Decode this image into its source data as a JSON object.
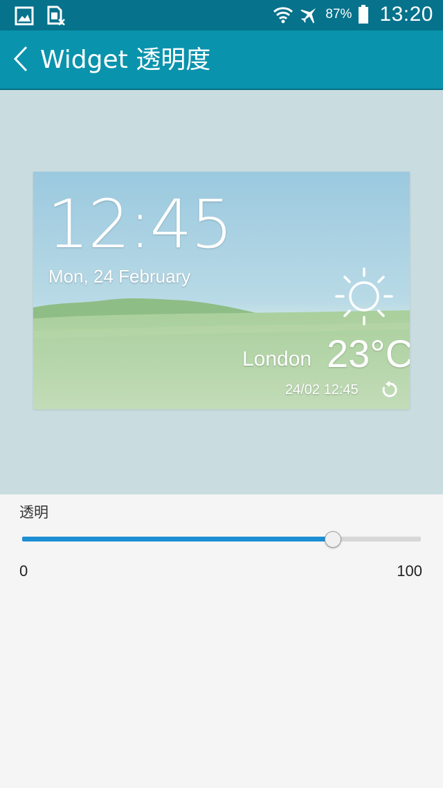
{
  "status_bar": {
    "left_icons": [
      "gallery-icon",
      "sim-disabled-icon"
    ],
    "right_icons": [
      "wifi-icon",
      "airplane-mode-icon",
      "battery-icon"
    ],
    "battery_percent": "87%",
    "time": "13:20",
    "background": "#06728b"
  },
  "app_bar": {
    "title": "Widget 透明度",
    "back_icon": "chevron-left-icon",
    "background": "#0a93ad"
  },
  "widget_preview": {
    "time": "12:45",
    "date": "Mon, 24 February",
    "weather_icon": "sun-icon",
    "city": "London",
    "temperature": "23°C",
    "updated": "24/02 12:45",
    "refresh_icon": "refresh-icon",
    "background": "#c9dde0"
  },
  "transparency": {
    "label": "透明",
    "min_label": "0",
    "max_label": "100",
    "value_fraction": 0.78,
    "accent": "#1c8ed3"
  }
}
